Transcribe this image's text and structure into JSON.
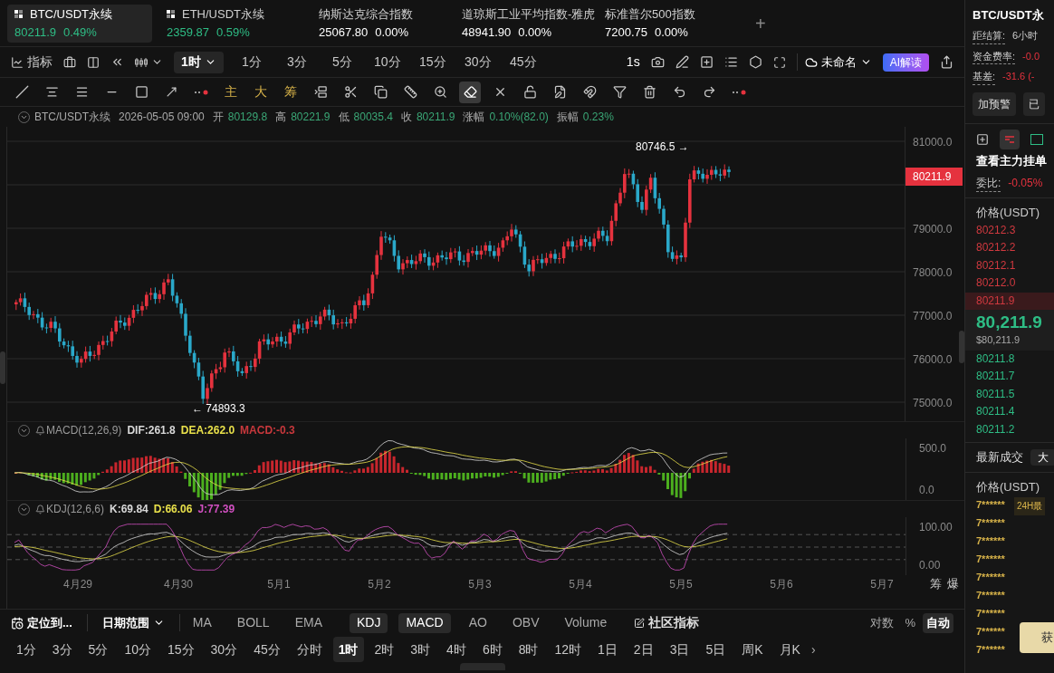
{
  "tickers": [
    {
      "kind": "perpetual",
      "name": "BTC/USDT永续",
      "price": "80211.9",
      "change": "0.49%",
      "selected": true
    },
    {
      "kind": "perpetual",
      "name": "ETH/USDT永续",
      "price": "2359.87",
      "change": "0.59%",
      "selected": false
    },
    {
      "kind": "index",
      "name": "纳斯达克综合指数",
      "price": "25067.80",
      "change": "0.00%",
      "selected": false
    },
    {
      "kind": "index",
      "name": "道琼斯工业平均指数-雅虎",
      "price": "48941.90",
      "change": "0.00%",
      "selected": false
    },
    {
      "kind": "index",
      "name": "标准普尔500指数",
      "price": "7200.75",
      "change": "0.00%",
      "selected": false
    }
  ],
  "add_tab": "+",
  "toolbar": {
    "indicator_label": "指标",
    "interval": "1时",
    "intervals": [
      "1分",
      "3分",
      "5分",
      "10分",
      "15分",
      "30分",
      "45分"
    ],
    "speed": "1s",
    "layout_name": "未命名",
    "ai_button": "AI解读"
  },
  "drawing_tools": [
    {
      "kind": "icon",
      "selected": false
    },
    {
      "kind": "icon",
      "selected": false
    },
    {
      "kind": "icon",
      "selected": false
    },
    {
      "kind": "icon",
      "selected": false
    },
    {
      "kind": "icon",
      "selected": false
    },
    {
      "kind": "icon",
      "selected": false
    },
    {
      "kind": "icon",
      "selected": false
    },
    {
      "kind": "text",
      "label": "主",
      "selected": false
    },
    {
      "kind": "text",
      "label": "大",
      "selected": false
    },
    {
      "kind": "text",
      "label": "筹",
      "selected": false
    },
    {
      "kind": "icon",
      "selected": false
    },
    {
      "kind": "icon",
      "selected": false
    },
    {
      "kind": "icon",
      "selected": false
    },
    {
      "kind": "icon",
      "selected": false
    },
    {
      "kind": "icon",
      "selected": false
    },
    {
      "kind": "icon",
      "selected": true
    },
    {
      "kind": "icon",
      "selected": false
    },
    {
      "kind": "icon",
      "selected": false
    },
    {
      "kind": "icon",
      "selected": false
    },
    {
      "kind": "icon",
      "selected": false
    },
    {
      "kind": "icon",
      "selected": false
    },
    {
      "kind": "icon",
      "selected": false
    },
    {
      "kind": "icon",
      "selected": false
    },
    {
      "kind": "icon",
      "selected": false
    },
    {
      "kind": "icon",
      "selected": false
    }
  ],
  "chart": {
    "symbol": "BTC/USDT永续",
    "datetime": "2026-05-05 09:00",
    "fields": [
      {
        "label": "开",
        "value": "80129.8"
      },
      {
        "label": "高",
        "value": "80221.9"
      },
      {
        "label": "低",
        "value": "80035.4"
      },
      {
        "label": "收",
        "value": "80211.9"
      },
      {
        "label": "涨幅",
        "value": "0.10%(82.0)"
      },
      {
        "label": "振幅",
        "value": "0.23%"
      }
    ],
    "price_ticks": [
      "81000.0",
      "79000.0",
      "78000.0",
      "77000.0",
      "76000.0",
      "75000.0"
    ],
    "current_price": "80211.9",
    "high_label": "80746.5 →",
    "low_label": "← 74893.3"
  },
  "macd": {
    "title": "MACD(12,26,9)",
    "values": [
      {
        "text": "DIF:261.8",
        "color": "#d8d8d8"
      },
      {
        "text": "DEA:262.0",
        "color": "#e8e04a"
      },
      {
        "text": "MACD:-0.3",
        "color": "#c8383c"
      }
    ],
    "ticks": [
      "500.0",
      "0.0"
    ]
  },
  "kdj": {
    "title": "KDJ(12,6,6)",
    "values": [
      {
        "text": "K:69.84",
        "color": "#d8d8d8"
      },
      {
        "text": "D:66.06",
        "color": "#e8e04a"
      },
      {
        "text": "J:77.39",
        "color": "#d04fc0"
      }
    ],
    "ticks": [
      "100.00",
      "0.00"
    ]
  },
  "date_ticks": [
    "4月29",
    "4月30",
    "5月1",
    "5月2",
    "5月3",
    "5月4",
    "5月5",
    "5月6",
    "5月7"
  ],
  "side_labels": [
    "筹",
    "爆"
  ],
  "indicator_bar": {
    "locate": "定位到...",
    "date_range": "日期范围",
    "indicators": [
      {
        "label": "MA",
        "selected": false
      },
      {
        "label": "BOLL",
        "selected": false
      },
      {
        "label": "EMA",
        "selected": false
      },
      {
        "label": "KDJ",
        "selected": true
      },
      {
        "label": "MACD",
        "selected": true
      },
      {
        "label": "AO",
        "selected": false
      },
      {
        "label": "OBV",
        "selected": false
      },
      {
        "label": "Volume",
        "selected": false
      }
    ],
    "community": "社区指标",
    "scales": [
      {
        "label": "对数",
        "selected": false
      },
      {
        "label": "%",
        "selected": false
      },
      {
        "label": "自动",
        "selected": true
      }
    ]
  },
  "interval_bar": [
    {
      "label": "1分",
      "selected": false
    },
    {
      "label": "3分",
      "selected": false
    },
    {
      "label": "5分",
      "selected": false
    },
    {
      "label": "10分",
      "selected": false
    },
    {
      "label": "15分",
      "selected": false
    },
    {
      "label": "30分",
      "selected": false
    },
    {
      "label": "45分",
      "selected": false
    },
    {
      "label": "分时",
      "selected": false
    },
    {
      "label": "1时",
      "selected": true
    },
    {
      "label": "2时",
      "selected": false
    },
    {
      "label": "3时",
      "selected": false
    },
    {
      "label": "4时",
      "selected": false
    },
    {
      "label": "6时",
      "selected": false
    },
    {
      "label": "8时",
      "selected": false
    },
    {
      "label": "12时",
      "selected": false
    },
    {
      "label": "1日",
      "selected": false
    },
    {
      "label": "2日",
      "selected": false
    },
    {
      "label": "3日",
      "selected": false
    },
    {
      "label": "5日",
      "selected": false
    },
    {
      "label": "周K",
      "selected": false
    },
    {
      "label": "月K",
      "selected": false
    }
  ],
  "interval_more": "›",
  "right_panel": {
    "title": "BTC/USDT永",
    "stats": [
      {
        "label": "距结算:",
        "value": "6小时",
        "kind": "neutral"
      },
      {
        "label": "资金费率:",
        "value": "-0.0",
        "kind": "down"
      },
      {
        "label": "基差:",
        "value": "-31.6 (-",
        "kind": "down"
      }
    ],
    "buttons": [
      "加预警",
      "已"
    ],
    "depth_title": "查看主力挂单",
    "ratio_label": "委比:",
    "ratio_value": "-0.05%",
    "price_header": "价格(USDT)",
    "asks": [
      {
        "price": "80212.3",
        "selected": false
      },
      {
        "price": "80212.2",
        "selected": false
      },
      {
        "price": "80212.1",
        "selected": false
      },
      {
        "price": "80212.0",
        "selected": false
      },
      {
        "price": "80211.9",
        "selected": true
      }
    ],
    "last_price": "80,211.9",
    "last_price_usd": "$80,211.9",
    "bids": [
      "80211.8",
      "80211.7",
      "80211.5",
      "80211.4",
      "80211.2"
    ],
    "trades_title": "最新成交",
    "trades_filter": "大",
    "trades_header": "价格(USDT)",
    "trades": [
      "7******",
      "7******",
      "7******",
      "7******",
      "7******",
      "7******",
      "7******",
      "7******",
      "7******"
    ],
    "tooltip": "24H最",
    "cta": "获"
  }
}
